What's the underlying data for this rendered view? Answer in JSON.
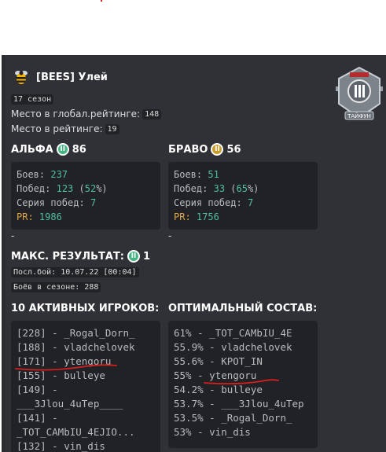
{
  "clan": {
    "title": "[BEES] Улей",
    "season": "17 сезон",
    "global_rank_label": "Место в глобал.рейтинге:",
    "global_rank_value": "148",
    "rank_label": "Место в рейтинге:",
    "rank_value": "19",
    "emblem_text": "ТАЙФУН"
  },
  "alpha": {
    "title": "АЛЬФА",
    "tier_value": "86",
    "battles_label": "Боев:",
    "battles": "237",
    "wins_label": "Побед:",
    "wins": "123",
    "wins_pct": "52",
    "streak_label": "Серия побед:",
    "streak": "7",
    "pr_label": "PR:",
    "pr": "1986"
  },
  "bravo": {
    "title": "БРАВО",
    "tier_value": "56",
    "battles_label": "Боев:",
    "battles": "51",
    "wins_label": "Побед:",
    "wins": "33",
    "wins_pct": "65",
    "streak_label": "Серия побед:",
    "streak": "7",
    "pr_label": "PR:",
    "pr": "1756"
  },
  "dash": "-",
  "max_result": {
    "title": "МАКС. РЕЗУЛЬТАТ:",
    "value": "1",
    "last_battle": "Посл.бой: 10.07.22 [00:04]",
    "season_battles": "Боёв в сезоне: 288"
  },
  "active_players": {
    "title": "10 АКТИВНЫХ ИГРОКОВ:",
    "lines": [
      "[228] - _Rogal_Dorn_",
      "[188] - vladchelovek",
      "[171] - ytengoru",
      "[155] - bulleye",
      "[149] -",
      "___3Jlou_4uTep____",
      "[141] -",
      "_TOT_CAMbIU_4EJIO...",
      "[132] - vin_dis"
    ]
  },
  "optimal": {
    "title": "ОПТИМАЛЬНЫЙ СОСТАВ:",
    "lines": [
      "61% - _TOT_CAMbIU_4E",
      "55.9% - vladchelovek",
      "55.6% - KPOT_IN",
      "55% - ytengoru",
      "54.2% - bulleye",
      "53.7% - ___3Jlou_4uTep",
      "53.5% - _Rogal_Dorn_",
      "53% - vin_dis"
    ]
  },
  "colors": {
    "background": "#2f3136",
    "code_bg": "#202225",
    "accent_green": "#43b581",
    "accent_orange": "#c99c2b",
    "number": "#4fbf9f",
    "pr": "#e0a84a",
    "annotation_red": "#d42020"
  },
  "icons": {
    "clan": "bee-icon",
    "alpha_tier": "tier-two-green-icon",
    "bravo_tier": "tier-two-orange-icon",
    "max_tier": "tier-two-green-icon",
    "emblem": "clan-emblem-icon"
  }
}
